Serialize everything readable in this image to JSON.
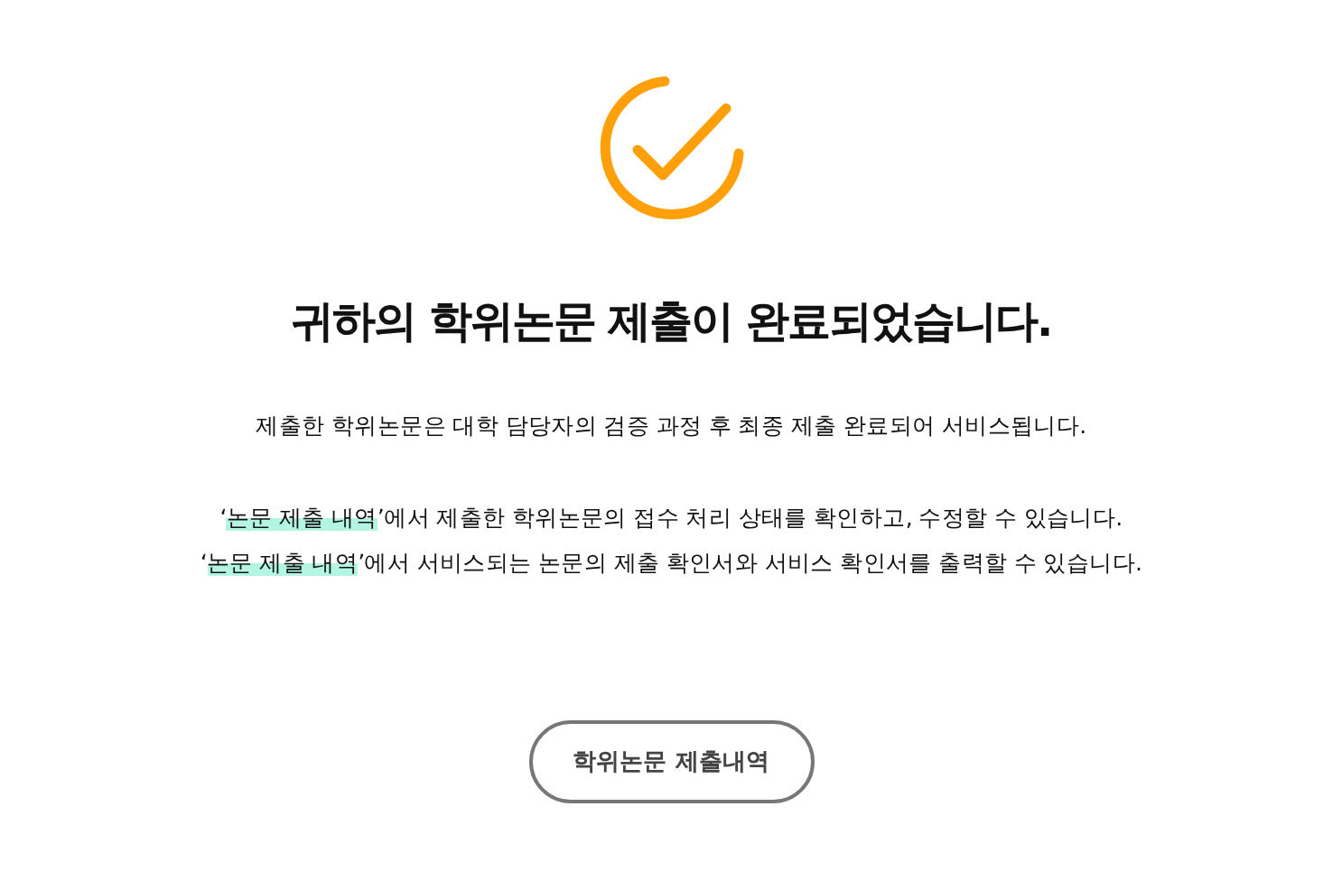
{
  "title": "귀하의 학위논문 제출이 완료되었습니다.",
  "notice": "제출한 학위논문은 대학 담당자의 검증 과정 후 최종 제출 완료되어 서비스됩니다.",
  "guides": [
    {
      "lead": "‘",
      "highlight": "논문 제출 내역",
      "rest": "’에서 제출한 학위논문의 접수 처리 상태를 확인하고, 수정할 수 있습니다."
    },
    {
      "lead": "‘",
      "highlight": "논문 제출 내역",
      "rest": "’에서 서비스되는 논문의 제출 확인서와 서비스 확인서를 출력할 수 있습니다."
    }
  ],
  "button": "학위논문 제출내역"
}
